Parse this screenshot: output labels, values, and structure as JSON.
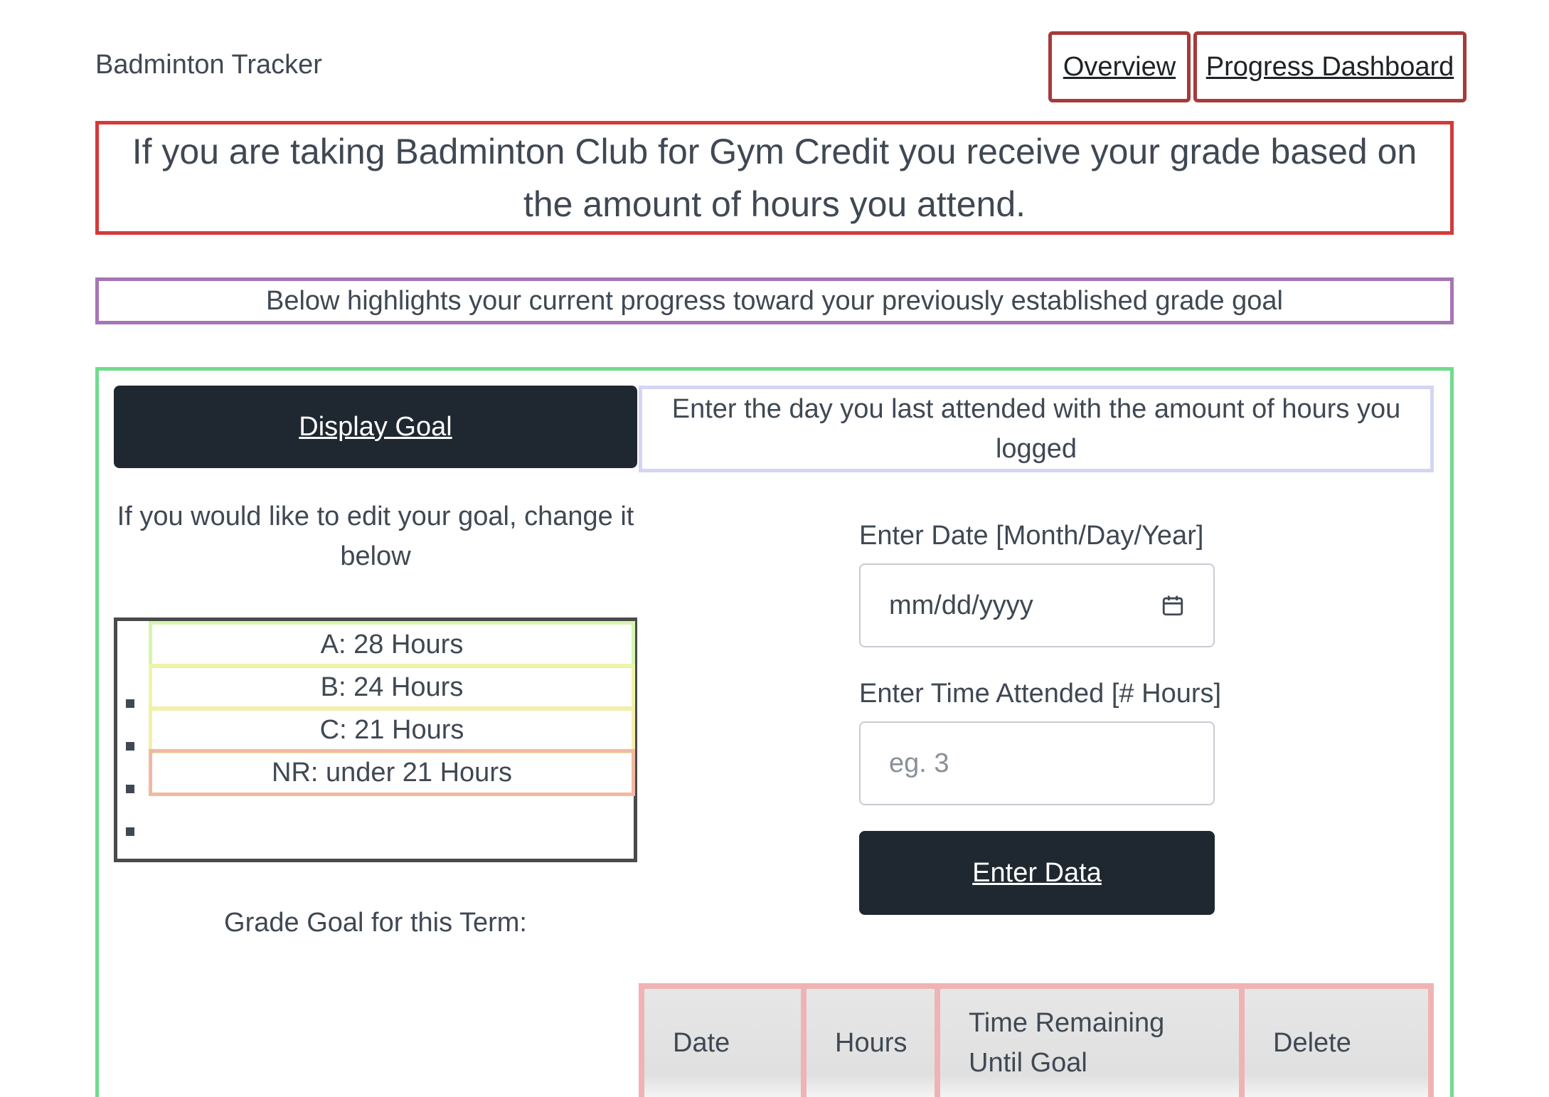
{
  "header": {
    "brand": "Badminton Tracker",
    "nav": [
      {
        "label": "Overview"
      },
      {
        "label": "Progress Dashboard"
      }
    ]
  },
  "intro": "If you are taking Badminton Club for Gym Credit you receive your grade based on the amount of hours you attend.",
  "subtitle": "Below highlights your current progress toward your previously established grade goal",
  "goal_panel": {
    "display_goal_label": "Display Goal",
    "edit_text": "If you would like to edit your goal, change it below",
    "grades": [
      {
        "label": "A: 28 Hours",
        "color": "#d6f5b0"
      },
      {
        "label": "B: 24 Hours",
        "color": "#eef5a8"
      },
      {
        "label": "C: 21 Hours",
        "color": "#f5eea8"
      },
      {
        "label": "NR: under 21 Hours",
        "color": "#f2b8a0"
      }
    ],
    "goal_term_label": "Grade Goal for this Term:"
  },
  "entry_panel": {
    "instructions": "Enter the day you last attended with the amount of hours you logged",
    "date_label": "Enter Date [Month/Day/Year]",
    "date_placeholder": "mm/dd/yyyy",
    "date_icon": "calendar-icon",
    "hours_label": "Enter Time Attended [# Hours]",
    "hours_placeholder": "eg. 3",
    "submit_label": "Enter Data"
  },
  "table": {
    "headers": [
      "Date",
      "Hours",
      "Time Remaining Until Goal",
      "Delete"
    ]
  },
  "colors": {
    "dark_button": "#1f2830",
    "nav_border": "#a63a3a",
    "intro_border": "#d43a3a",
    "subtitle_border": "#a675b5",
    "main_border": "#6fdc8c",
    "table_border": "#f0b3b3"
  }
}
